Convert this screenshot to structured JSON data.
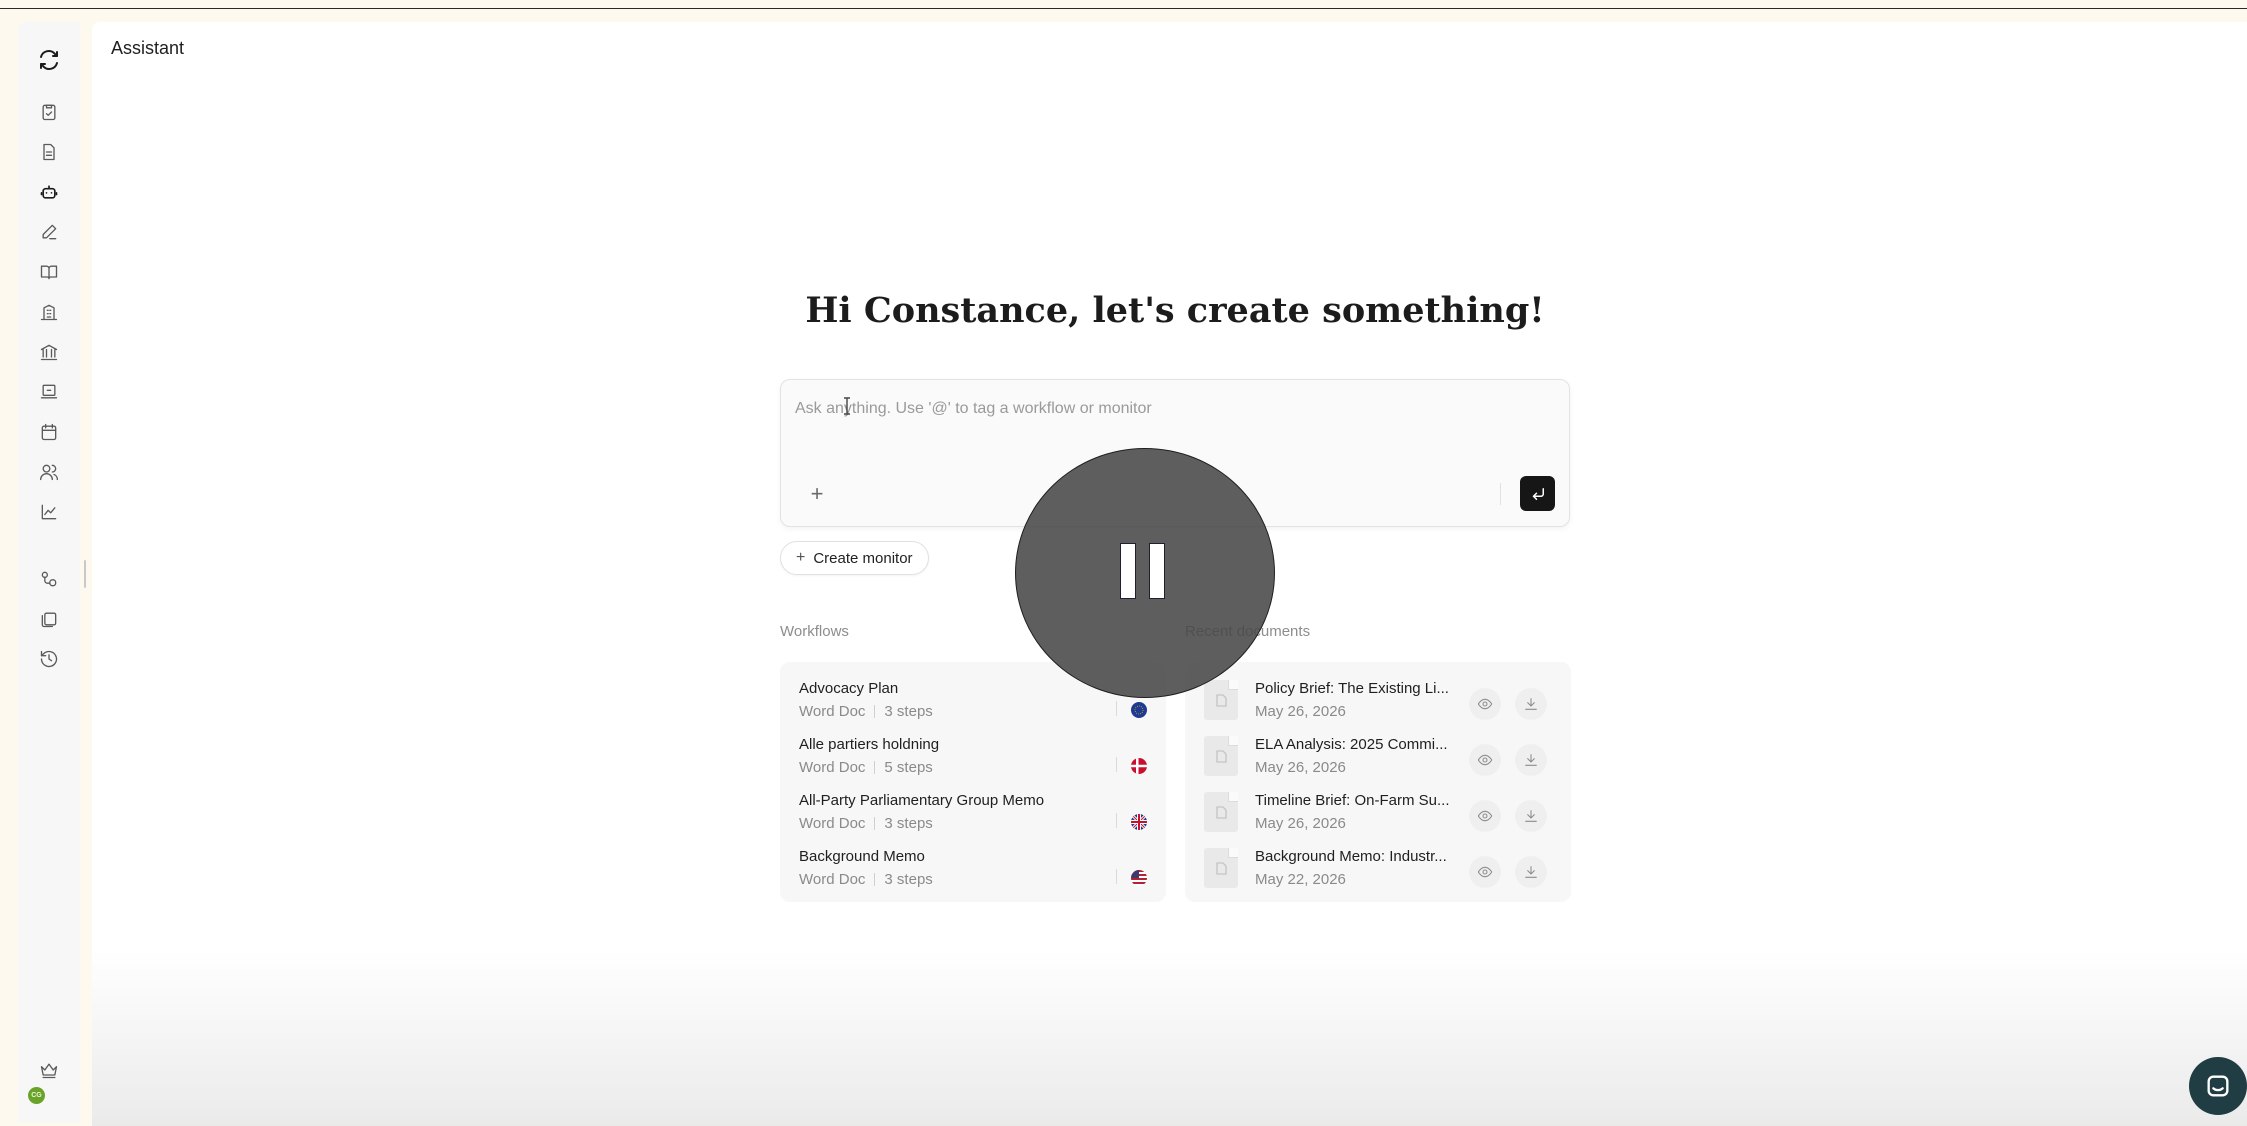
{
  "header": {
    "title": "Assistant"
  },
  "greeting": "Hi Constance, let's create something!",
  "composer": {
    "placeholder": "Ask anything. Use '@' to tag a workflow or monitor",
    "add_label": "+"
  },
  "create_monitor": {
    "icon": "+",
    "label": "Create monitor"
  },
  "workflows": {
    "label": "Workflows",
    "items": [
      {
        "title": "Advocacy Plan",
        "type": "Word Doc",
        "steps": "3 steps",
        "flag": "eu-flag"
      },
      {
        "title": "Alle partiers holdning",
        "type": "Word Doc",
        "steps": "5 steps",
        "flag": "denmark-flag"
      },
      {
        "title": "All-Party Parliamentary Group Memo",
        "type": "Word Doc",
        "steps": "3 steps",
        "flag": "uk-flag"
      },
      {
        "title": "Background Memo",
        "type": "Word Doc",
        "steps": "3 steps",
        "flag": "us-flag"
      }
    ]
  },
  "recent_documents": {
    "label": "Recent documents",
    "items": [
      {
        "title": "Policy Brief: The Existing Li...",
        "date": "May 26, 2026"
      },
      {
        "title": "ELA Analysis: 2025 Commi...",
        "date": "May 26, 2026"
      },
      {
        "title": "Timeline Brief: On-Farm Su...",
        "date": "May 26, 2026"
      },
      {
        "title": "Background Memo: Industr...",
        "date": "May 22, 2026"
      }
    ]
  },
  "user": {
    "initials": "CG"
  },
  "colors": {
    "send_button": "#161616",
    "avatar": "#6aa329",
    "chat_bubble": "#1f3d43"
  }
}
